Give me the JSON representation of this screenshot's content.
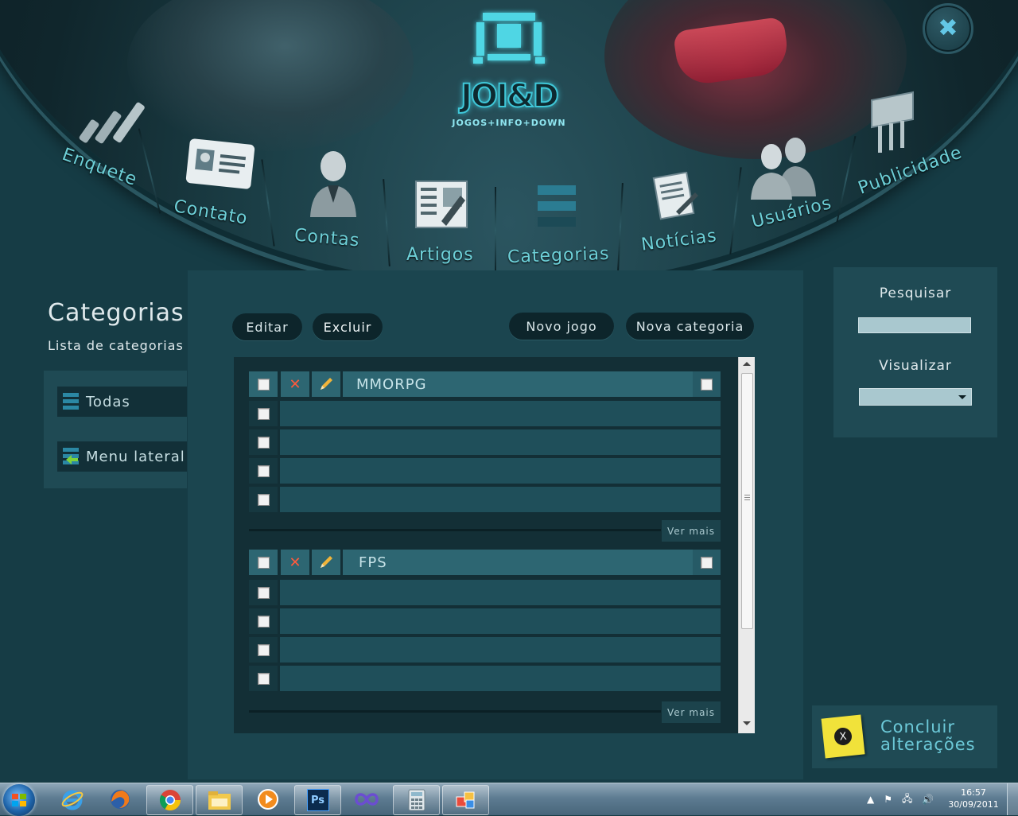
{
  "app": {
    "logo_text": "JOI&D",
    "logo_tagline": "JOGOS+INFO+DOWN"
  },
  "nav": {
    "items": [
      {
        "label": "Enquete",
        "icon": "poll-bars-icon"
      },
      {
        "label": "Contato",
        "icon": "contact-card-icon"
      },
      {
        "label": "Contas",
        "icon": "user-account-icon"
      },
      {
        "label": "Artigos",
        "icon": "article-edit-icon"
      },
      {
        "label": "Categorias",
        "icon": "category-list-icon"
      },
      {
        "label": "Notícias",
        "icon": "news-document-icon"
      },
      {
        "label": "Usuários",
        "icon": "users-group-icon"
      },
      {
        "label": "Publicidade",
        "icon": "billboard-icon"
      }
    ]
  },
  "page": {
    "title": "Categorias",
    "subtitle": "Lista de categorias"
  },
  "sidebar": {
    "items": [
      {
        "label": "Todas",
        "icon": "list-icon"
      },
      {
        "label": "Menu lateral",
        "icon": "side-menu-arrow-icon"
      }
    ]
  },
  "toolbar": {
    "edit_label": "Editar",
    "delete_label": "Excluir",
    "new_game_label": "Novo jogo",
    "new_category_label": "Nova categoria"
  },
  "categories": [
    {
      "name": "MMORPG",
      "rows": 4,
      "more_label": "Ver mais"
    },
    {
      "name": "FPS",
      "rows": 4,
      "more_label": "Ver mais"
    }
  ],
  "right_panel": {
    "search_label": "Pesquisar",
    "search_value": "",
    "view_label": "Visualizar",
    "view_value": ""
  },
  "finish": {
    "line1": "Concluir",
    "line2": "alterações",
    "note_letter": "X"
  },
  "taskbar": {
    "apps": [
      "internet-explorer-icon",
      "firefox-icon",
      "chrome-icon",
      "file-explorer-icon",
      "media-player-icon",
      "photoshop-icon",
      "visual-studio-icon",
      "calculator-icon",
      "paint-icon"
    ],
    "photoshop_label": "Ps",
    "time": "16:57",
    "date": "30/09/2011"
  },
  "colors": {
    "accent": "#6dd0d8",
    "background": "#163c45",
    "panel": "#1f4a54",
    "row": "#1f4f5a",
    "header_row": "#2d6672"
  }
}
